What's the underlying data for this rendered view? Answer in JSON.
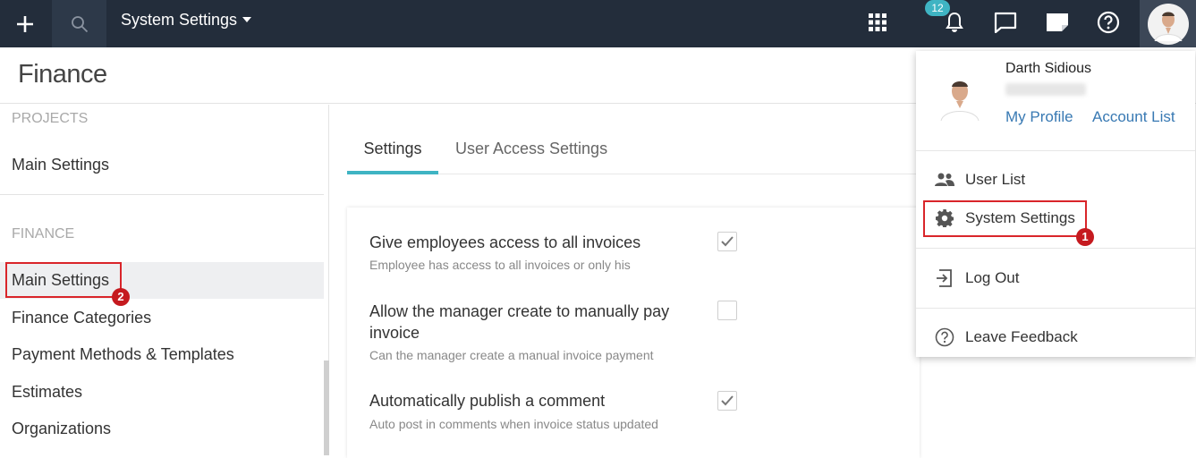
{
  "topbar": {
    "title": "System Settings",
    "notification_count": "12",
    "icons": [
      "plus-icon",
      "search-icon",
      "apps-grid-icon",
      "bell-icon",
      "chat-icon",
      "note-icon",
      "help-icon"
    ]
  },
  "header": {
    "title": "Finance"
  },
  "sidebar": {
    "sections": [
      {
        "label": "PROJECTS",
        "items": [
          "Main Settings"
        ]
      },
      {
        "label": "FINANCE",
        "items": [
          "Main Settings",
          "Finance Categories",
          "Payment Methods & Templates",
          "Estimates",
          "Organizations"
        ]
      }
    ],
    "active_item": "Main Settings"
  },
  "annotations": {
    "first": "1",
    "second": "2",
    "highlight_color": "#d9252a"
  },
  "tabs": [
    {
      "label": "Settings",
      "active": true
    },
    {
      "label": "User Access Settings",
      "active": false
    }
  ],
  "settings": [
    {
      "title": "Give employees access to all invoices",
      "desc": "Employee has access to all invoices or only his",
      "checked": true
    },
    {
      "title": "Allow the manager create to manually pay invoice",
      "desc": "Can the manager create a manual invoice payment",
      "checked": false
    },
    {
      "title": "Automatically publish a comment",
      "desc": "Auto post in comments when invoice status updated",
      "checked": true
    }
  ],
  "dropdown": {
    "user_name": "Darth Sidious",
    "my_profile": "My Profile",
    "account_list": "Account List",
    "items": [
      {
        "label": "User List",
        "icon": "users-icon"
      },
      {
        "label": "System Settings",
        "icon": "gear-icon"
      },
      {
        "label": "Log Out",
        "icon": "logout-icon"
      },
      {
        "label": "Leave Feedback",
        "icon": "help-circle-icon"
      }
    ]
  },
  "colors": {
    "topbar": "#232d3b",
    "accent": "#3fb4c3",
    "link": "#3879b3",
    "highlight": "#d9252a"
  }
}
